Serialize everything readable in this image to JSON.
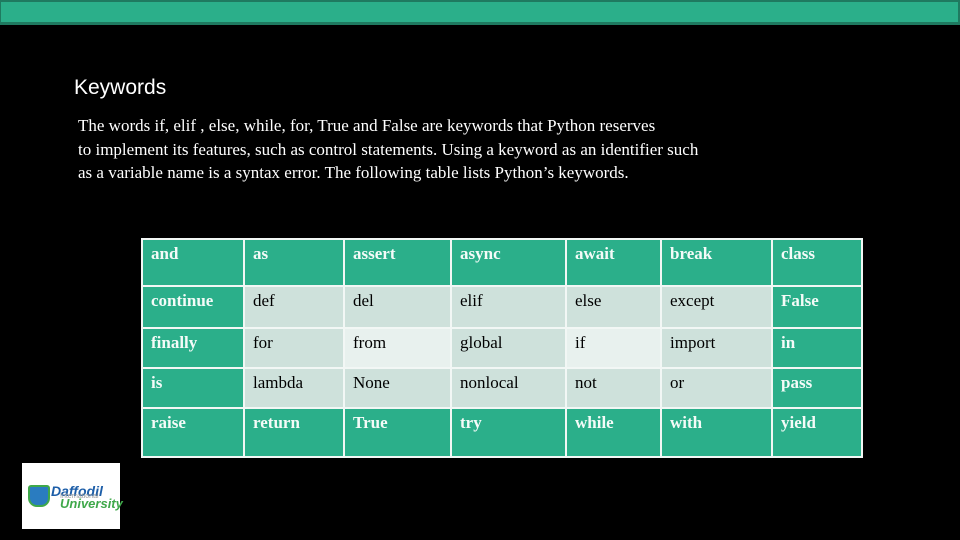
{
  "slide": {
    "title": "Keywords",
    "paragraph_lines": [
      "The words if, elif  , else, while, for, True and False are keywords that Python reserves",
      "to implement its features, such as control statements. Using a keyword as an identifier such",
      "as a variable name is a syntax error. The following table lists Python’s keywords."
    ],
    "table": {
      "rows": [
        [
          "and",
          "as",
          "assert",
          "async",
          "await",
          "break",
          "class"
        ],
        [
          "continue",
          "def",
          "del",
          "elif",
          "else",
          "except",
          "False"
        ],
        [
          "finally",
          "for",
          "from",
          "global",
          "if",
          "import",
          "in"
        ],
        [
          "is",
          "lambda",
          "None",
          "nonlocal",
          "not",
          "or",
          "pass"
        ],
        [
          "raise",
          "return",
          "True",
          "try",
          "while",
          "with",
          "yield"
        ]
      ]
    },
    "logo": {
      "line1": "Daffodil",
      "line2": "International",
      "line3": "University"
    }
  },
  "colors": {
    "accent": "#2baf8a",
    "cell_light": "#cee1db",
    "cell_lighter": "#e8f1ee",
    "background": "#000000"
  }
}
